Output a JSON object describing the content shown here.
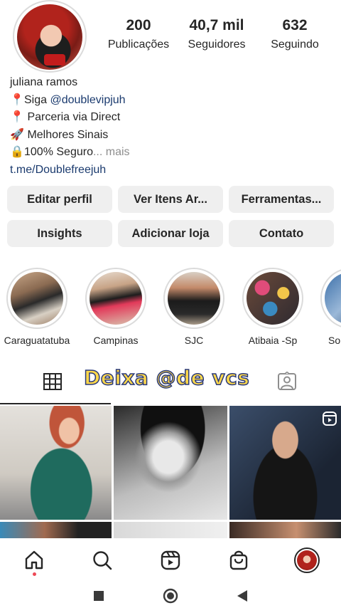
{
  "profile": {
    "posts_count": "200",
    "posts_label": "Publicações",
    "followers_count": "40,7 mil",
    "followers_label": "Seguidores",
    "following_count": "632",
    "following_label": "Seguindo",
    "name": "juliana ramos",
    "bio_line1_prefix": "Siga ",
    "bio_line1_handle": "@doublevipjuh",
    "bio_line2": "Parceria via Direct",
    "bio_line3": "Melhores Sinais",
    "bio_line4": "100% Seguro",
    "bio_more": "... mais",
    "link": "t.me/Doublefreejuh"
  },
  "buttons": {
    "edit_profile": "Editar perfil",
    "archived_items": "Ver Itens Ar...",
    "tools": "Ferramentas...",
    "insights": "Insights",
    "add_shop": "Adicionar loja",
    "contact": "Contato"
  },
  "highlights": [
    {
      "label": "Caraguatatuba"
    },
    {
      "label": "Campinas"
    },
    {
      "label": "SJC"
    },
    {
      "label": "Atibaia -Sp"
    },
    {
      "label": "So"
    }
  ],
  "overlay_caption": "Deixa @de vcs",
  "icons": {
    "grid_tab": "grid-icon",
    "tagged_tab": "tagged-person-icon",
    "reel_badge": "reels-icon",
    "nav": [
      "home-icon",
      "search-icon",
      "reels-icon",
      "shop-icon",
      "profile-avatar"
    ]
  },
  "colors": {
    "button_bg": "#efefef",
    "link": "#1a3a6e",
    "notification_dot": "#ed4956",
    "overlay_text": "#ffd84a"
  }
}
